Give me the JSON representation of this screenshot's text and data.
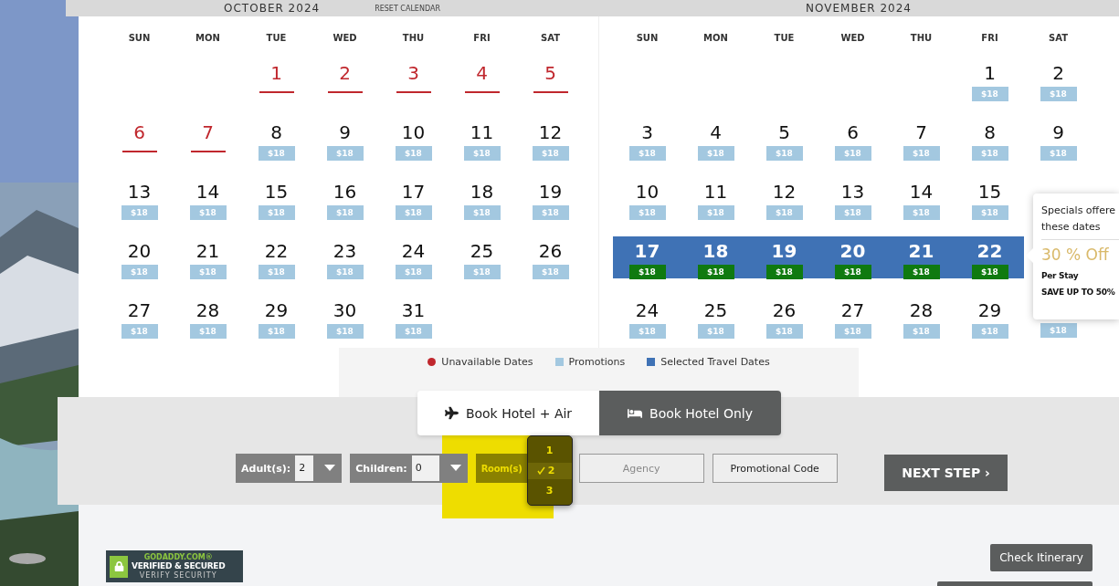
{
  "calendar": {
    "reset_label": "RESET CALENDAR",
    "months": [
      {
        "title": "OCTOBER  2024",
        "weekdays": [
          "SUN",
          "MON",
          "TUE",
          "WED",
          "THU",
          "FRI",
          "SAT"
        ],
        "weeks": [
          [
            {
              "day": "1",
              "unavailable": true,
              "selected": false
            },
            {
              "day": "2",
              "unavailable": true,
              "selected": false
            },
            {
              "day": "3",
              "unavailable": true,
              "selected": false
            },
            {
              "day": "4",
              "unavailable": true,
              "selected": false
            },
            {
              "day": "5",
              "unavailable": true,
              "selected": false
            }
          ],
          [
            {
              "day": "6",
              "unavailable": true,
              "selected": false
            },
            {
              "day": "7",
              "unavailable": true,
              "selected": false
            },
            {
              "day": "8",
              "unavailable": false,
              "selected": false,
              "price": "$18"
            },
            {
              "day": "9",
              "unavailable": false,
              "selected": false,
              "price": "$18"
            },
            {
              "day": "10",
              "unavailable": false,
              "selected": false,
              "price": "$18"
            },
            {
              "day": "11",
              "unavailable": false,
              "selected": false,
              "price": "$18"
            },
            {
              "day": "12",
              "unavailable": false,
              "selected": false,
              "price": "$18"
            }
          ],
          [
            {
              "day": "13",
              "unavailable": false,
              "selected": false,
              "price": "$18"
            },
            {
              "day": "14",
              "unavailable": false,
              "selected": false,
              "price": "$18"
            },
            {
              "day": "15",
              "unavailable": false,
              "selected": false,
              "price": "$18"
            },
            {
              "day": "16",
              "unavailable": false,
              "selected": false,
              "price": "$18"
            },
            {
              "day": "17",
              "unavailable": false,
              "selected": false,
              "price": "$18"
            },
            {
              "day": "18",
              "unavailable": false,
              "selected": false,
              "price": "$18"
            },
            {
              "day": "19",
              "unavailable": false,
              "selected": false,
              "price": "$18"
            }
          ],
          [
            {
              "day": "20",
              "unavailable": false,
              "selected": false,
              "price": "$18"
            },
            {
              "day": "21",
              "unavailable": false,
              "selected": false,
              "price": "$18"
            },
            {
              "day": "22",
              "unavailable": false,
              "selected": false,
              "price": "$18"
            },
            {
              "day": "23",
              "unavailable": false,
              "selected": false,
              "price": "$18"
            },
            {
              "day": "24",
              "unavailable": false,
              "selected": false,
              "price": "$18"
            },
            {
              "day": "25",
              "unavailable": false,
              "selected": false,
              "price": "$18"
            },
            {
              "day": "26",
              "unavailable": false,
              "selected": false,
              "price": "$18"
            }
          ],
          [
            {
              "day": "27",
              "unavailable": false,
              "selected": false,
              "price": "$18"
            },
            {
              "day": "28",
              "unavailable": false,
              "selected": false,
              "price": "$18"
            },
            {
              "day": "29",
              "unavailable": false,
              "selected": false,
              "price": "$18"
            },
            {
              "day": "30",
              "unavailable": false,
              "selected": false,
              "price": "$18"
            },
            {
              "day": "31",
              "unavailable": false,
              "selected": false,
              "price": "$18"
            }
          ]
        ]
      },
      {
        "title": "NOVEMBER  2024",
        "weekdays": [
          "SUN",
          "MON",
          "TUE",
          "WED",
          "THU",
          "FRI",
          "SAT"
        ],
        "weeks": [
          [
            {
              "day": "1",
              "unavailable": false,
              "selected": false,
              "price": "$18"
            },
            {
              "day": "2",
              "unavailable": false,
              "selected": false,
              "price": "$18"
            }
          ],
          [
            {
              "day": "3",
              "unavailable": false,
              "selected": false,
              "price": "$18"
            },
            {
              "day": "4",
              "unavailable": false,
              "selected": false,
              "price": "$18"
            },
            {
              "day": "5",
              "unavailable": false,
              "selected": false,
              "price": "$18"
            },
            {
              "day": "6",
              "unavailable": false,
              "selected": false,
              "price": "$18"
            },
            {
              "day": "7",
              "unavailable": false,
              "selected": false,
              "price": "$18"
            },
            {
              "day": "8",
              "unavailable": false,
              "selected": false,
              "price": "$18"
            },
            {
              "day": "9",
              "unavailable": false,
              "selected": false,
              "price": "$18"
            }
          ],
          [
            {
              "day": "10",
              "unavailable": false,
              "selected": false,
              "price": "$18"
            },
            {
              "day": "11",
              "unavailable": false,
              "selected": false,
              "price": "$18"
            },
            {
              "day": "12",
              "unavailable": false,
              "selected": false,
              "price": "$18"
            },
            {
              "day": "13",
              "unavailable": false,
              "selected": false,
              "price": "$18"
            },
            {
              "day": "14",
              "unavailable": false,
              "selected": false,
              "price": "$18"
            },
            {
              "day": "15",
              "unavailable": false,
              "selected": false,
              "price": "$18"
            }
          ],
          [
            {
              "day": "17",
              "unavailable": false,
              "selected": true,
              "price": "$18"
            },
            {
              "day": "18",
              "unavailable": false,
              "selected": true,
              "price": "$18"
            },
            {
              "day": "19",
              "unavailable": false,
              "selected": true,
              "price": "$18"
            },
            {
              "day": "20",
              "unavailable": false,
              "selected": true,
              "price": "$18"
            },
            {
              "day": "21",
              "unavailable": false,
              "selected": true,
              "price": "$18"
            },
            {
              "day": "22",
              "unavailable": false,
              "selected": true,
              "price": "$18"
            }
          ],
          [
            {
              "day": "24",
              "unavailable": false,
              "selected": false,
              "price": "$18"
            },
            {
              "day": "25",
              "unavailable": false,
              "selected": false,
              "price": "$18"
            },
            {
              "day": "26",
              "unavailable": false,
              "selected": false,
              "price": "$18"
            },
            {
              "day": "27",
              "unavailable": false,
              "selected": false,
              "price": "$18"
            },
            {
              "day": "28",
              "unavailable": false,
              "selected": false,
              "price": "$18"
            },
            {
              "day": "29",
              "unavailable": false,
              "selected": false,
              "price": "$18"
            },
            {
              "unavailable": false,
              "selected": false,
              "price": "$18"
            }
          ]
        ]
      }
    ],
    "tooltip": {
      "heading": "Specials offere",
      "heading_2": "these dates",
      "discount": "30 % Off",
      "unit": "Per Stay",
      "note": "SAVE UP TO 50%"
    },
    "legend": [
      {
        "kind": "dot",
        "label": "Unavailable Dates",
        "color": "#c0272d"
      },
      {
        "kind": "square",
        "label": "Promotions",
        "color": "#a3c8e0"
      },
      {
        "kind": "square",
        "label": "Selected Travel Dates",
        "color": "#3f72b5"
      }
    ]
  },
  "booking_tabs": [
    {
      "label": "Book Hotel + Air",
      "selected": false
    },
    {
      "label": "Book Hotel Only",
      "selected": true
    }
  ],
  "adults": {
    "label": "Adult(s):",
    "value": "2"
  },
  "children": {
    "label": "Children:",
    "value": "0"
  },
  "rooms": {
    "label": "Room(s)",
    "options": [
      {
        "label": "1",
        "selected": false
      },
      {
        "label": "2",
        "selected": true
      },
      {
        "label": "3",
        "selected": false
      }
    ]
  },
  "agency": {
    "placeholder": "Agency"
  },
  "promo_code": {
    "label": "Promotional Code"
  },
  "next_button": "NEXT STEP ›",
  "badge": {
    "line_1": "GODADDY.COM®",
    "line_2": "VERIFIED & SECURED",
    "line_3": "VERIFY SECURITY"
  },
  "check_itinerary": "Check Itinerary"
}
